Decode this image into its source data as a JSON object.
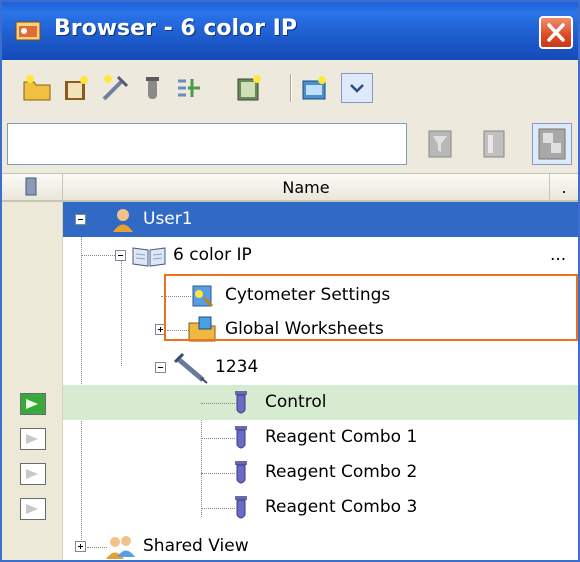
{
  "window": {
    "title": "Browser - 6 color IP"
  },
  "table": {
    "column_header": "Name",
    "sort_indicator": "."
  },
  "tree": {
    "user": "User1",
    "experiment": "6 color IP",
    "experiment_more": "...",
    "cytometer_settings": "Cytometer Settings",
    "global_worksheets": "Global Worksheets",
    "specimen": "1234",
    "tubes": [
      "Control",
      "Reagent Combo 1",
      "Reagent Combo 2",
      "Reagent Combo 3"
    ],
    "shared_view": "Shared View"
  },
  "icons": {
    "app": "browser-app-icon",
    "close": "close-icon",
    "toolbar": [
      "new-folder-icon",
      "new-experiment-icon",
      "new-specimen-icon",
      "new-tube-icon",
      "new-worksheet-icon",
      "new-panel-icon",
      "new-layout-icon",
      "dropdown-icon"
    ],
    "search_actions": [
      "filter-icon",
      "column-icon",
      "options-icon"
    ],
    "user": "user-icon",
    "experiment": "book-icon",
    "cytometer": "cytometer-settings-icon",
    "worksheets": "worksheets-folder-icon",
    "specimen": "syringe-icon",
    "tube": "tube-icon",
    "shared": "shared-users-icon"
  },
  "colors": {
    "titlebar": "#1f5fd0",
    "selection": "#316ac5",
    "current_row": "#d6ebd0",
    "callout": "#f07020",
    "indicator_on": "#3aa83a"
  }
}
